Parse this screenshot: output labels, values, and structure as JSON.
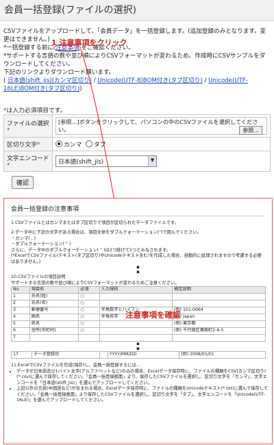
{
  "header": {
    "title": "会員一括登録(ファイルの選択)"
  },
  "intro": {
    "line1": "CSVファイルをアップロードして、「会員データ」を一括登録します。(追加登録のみとなります。変更はできません。)",
    "line2_pre": "*一括登録する前に",
    "line2_link": "注意事項",
    "line2_post": "をご確認ください。",
    "line3": "*サポートする言語の数や並び順によりCSVフォーマットが変わるため、作成時にCSVサンプルをダウンロードしてください。",
    "line4": "下記のリンクよりダウンロード願います。",
    "links": [
      "日本語(shift_jis)(カンマ区切り)",
      "Unicode(UTF-8)BOM付き(タブ区切り)",
      "Unicode(UTF-16LE)BOM付き(タブ区切り)"
    ],
    "sep": " / "
  },
  "callout_click": "1 注意事項をクリック",
  "callout_confirm": "注意事項を確認",
  "form": {
    "required_note_mark": "*",
    "required_note": "は入力必須項目です。",
    "file_label": "ファイルの選択",
    "file_hint": "[参照...]ボタンをクリックして、パソコンの中のCSVファイルを選択してください。",
    "browse_label": "参照...",
    "delimiter_label": "区切り文字",
    "delimiter_options": [
      "カンマ",
      "タブ"
    ],
    "encoding_label": "文字エンコード",
    "encoding_value": "日本語(shift_jis)",
    "req_mark": "*",
    "confirm_label": "確認"
  },
  "notice": {
    "title": "会員一括登録の注意事項",
    "p1": "1.CSVファイルとはカンマまたはタブ区切りで項目が区切られたデータファイルです。",
    "p2": "2.データ中に下記の文字がある場合は、項目全体をダブルクォーテーション(\")で囲んでください。",
    "p2a": "・カンマ( , )",
    "p2b": "・ダブルクォーテーション( \" )",
    "p2c": "さらに、データ中のダブルクォーテーション( \" )は2つ続けて1つとみなされます。",
    "p2d": "(*ExcelでCSVファイル(テキスト(タブ区切り)やUnicodeテキスト含む)を作成した場合、自動的に処理されますので考慮する必要はありません。)",
    "p10": "10.CSVファイルの項目説明",
    "p10sub": "サポートする言語の数や並び順によりCSVフォーマットが変わるためご注意ください。",
    "table_headers": [
      "No.",
      "項目名",
      "必須",
      "入力規則",
      "補足説明"
    ],
    "table_rows": [
      [
        "1",
        "氏名(姓)",
        "○",
        "",
        ""
      ],
      [
        "2",
        "氏名(名)",
        "○",
        "",
        ""
      ],
      [
        "3",
        "郵便番号",
        "○",
        "半角数字とハイフン",
        "(例) 101-0064"
      ],
      [
        "4",
        "国名",
        "○",
        "半角英字",
        "(例) Japan"
      ],
      [
        "5",
        "県名",
        "○",
        "",
        "(例) 東京都"
      ],
      [
        "6",
        "住所(市町村)",
        "○",
        "",
        "(例) 千代田区猿楽町2-6-5"
      ],
      [
        "7",
        "",
        "",
        "",
        ""
      ]
    ],
    "table_last_row": [
      "17",
      "データ登録日",
      "",
      "YYYY/MM/DD",
      "(例) 2008/01/01"
    ],
    "p11": "11.ExcelでCSVファイルを作成(保存)し、会員一括登録するには…",
    "b1": "データが日本語及び1バイト文字(アルファベットなど)のみの場合、Excelデータ保存時に、ファイルの種類をCSV(カンマ区切り)(*.csv)に選んで保存してください。「会員一括登録画面」より、保存したCSVファイルを選択し、区切り文字を「カンマ」、文字エンコードを「日本語(shift_jis)」を選んでアップロードしてください。",
    "b2": "上記以外の言語(中国語など)が含まれる場合、Excelデータ保存時に、ファイルの種類をUnicodeテキスト(*.txt)に選んで保存してください。「会員一括登録画面」より保存したCSVファイルを選択し、区切り文字を「タブ」、文字エンコードを「Unicode(UTF-16LE)」を選んでアップロードしてください。",
    "dots": "▪"
  },
  "colors": {
    "accent_red": "#e02020",
    "link_blue": "#1a4bbf"
  }
}
